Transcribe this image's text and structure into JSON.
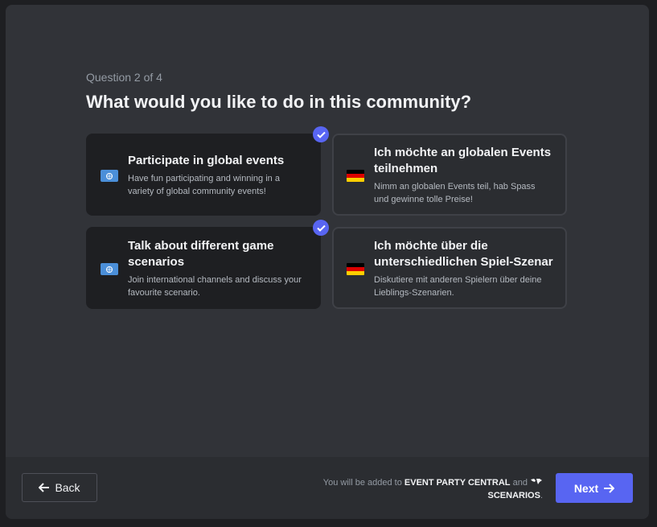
{
  "question": {
    "counter": "Question 2 of 4",
    "title": "What would you like to do in this community?"
  },
  "options": [
    {
      "label": "Participate in global events",
      "description": "Have fun participating and winning in a variety of global community events!",
      "icon": "un-flag-icon",
      "selected": true
    },
    {
      "label": "Ich möchte an globalen Events teilnehmen",
      "description": "Nimm an globalen Events teil, hab Spass und gewinne tolle Preise!",
      "icon": "germany-flag-icon",
      "selected": false
    },
    {
      "label": "Talk about different game scenarios",
      "description": "Join international channels and discuss your favourite scenario.",
      "icon": "un-flag-icon",
      "selected": true
    },
    {
      "label": "Ich möchte über die unterschiedlichen Spiel-Szenar",
      "description": "Diskutiere mit anderen Spielern über deine Lieblings-Szenarien.",
      "icon": "germany-flag-icon",
      "selected": false
    }
  ],
  "footer": {
    "back_label": "Back",
    "next_label": "Next",
    "notice_prefix": "You will be added to",
    "channel_1": "EVENT PARTY CENTRAL",
    "notice_and": "and",
    "channel_2": "SCENARIOS",
    "notice_suffix": "."
  },
  "colors": {
    "accent": "#5865f2",
    "modal_bg": "#313338",
    "selected_card_bg": "#1e1f22"
  }
}
